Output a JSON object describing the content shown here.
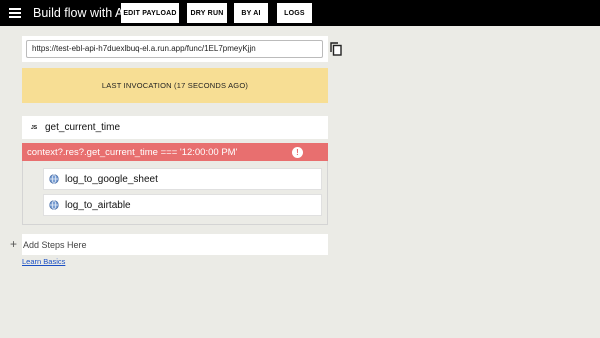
{
  "topbar": {
    "menu_icon": "hamburger-menu-icon",
    "title": "Build flow with AI",
    "buttons": {
      "edit_payload": "EDIT PAYLOAD",
      "dry_run": "DRY RUN",
      "by_ai": "BY AI",
      "logs": "LOGS"
    }
  },
  "endpoint": {
    "url": "https://test-ebl-api-h7duexlbuq-el.a.run.app/func/1EL7pmeyKjjn",
    "copy_icon": "copy-icon"
  },
  "invocation": {
    "label": "LAST INVOCATION (17 SECONDS AGO)"
  },
  "flow": {
    "js_step": {
      "badge": "JS",
      "label": "get_current_time"
    },
    "condition": {
      "expression": "context?.res?.get_current_time === '12:00:00 PM'",
      "alert_icon": "alert-circle-icon"
    },
    "sub_steps": [
      {
        "label": "log_to_google_sheet",
        "icon": "globe-icon"
      },
      {
        "label": "log_to_airtable",
        "icon": "globe-icon"
      }
    ]
  },
  "add_steps": {
    "label": "Add Steps Here",
    "icon": "plus-icon"
  },
  "learn_basics": "Learn Basics",
  "colors": {
    "topbar": "#000000",
    "background": "#ebebe6",
    "invocation_banner": "#f7de94",
    "condition": "#e86f6f",
    "link": "#1a4fc4"
  }
}
